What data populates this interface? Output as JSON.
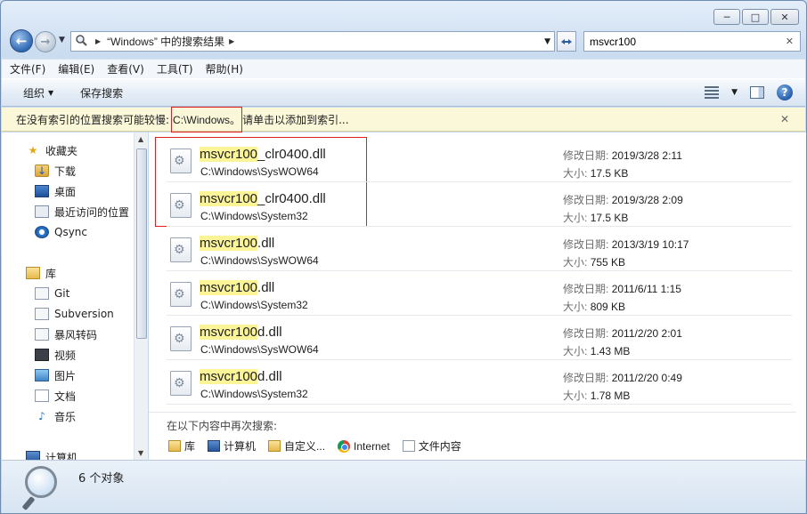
{
  "window": {
    "minimize_glyph": "─",
    "maximize_glyph": "□",
    "close_glyph": "✕"
  },
  "nav": {
    "back_glyph": "←",
    "forward_glyph": "→"
  },
  "address": {
    "path": "“Windows” 中的搜索结果",
    "sep": "▶"
  },
  "search": {
    "value": "msvcr100",
    "clear_glyph": "✕"
  },
  "menu": [
    "文件(F)",
    "编辑(E)",
    "查看(V)",
    "工具(T)",
    "帮助(H)"
  ],
  "toolbar": {
    "organize": "组织",
    "save_search": "保存搜索",
    "help_glyph": "?"
  },
  "infobar": {
    "prefix": "在没有索引的位置搜索可能较慢:",
    "location": "C:\\Windows。",
    "suffix": "请单击以添加到索引...",
    "close_glyph": "✕"
  },
  "sidebar": {
    "favorites": [
      {
        "label": "收藏夹",
        "icon": "star-icon"
      },
      {
        "label": "下载",
        "icon": "download-folder-icon"
      },
      {
        "label": "桌面",
        "icon": "desktop-icon"
      },
      {
        "label": "最近访问的位置",
        "icon": "recent-places-icon"
      },
      {
        "label": "Qsync",
        "icon": "qsync-icon"
      }
    ],
    "libraries": [
      {
        "label": "库",
        "icon": "library-icon"
      },
      {
        "label": "Git",
        "icon": "git-library-icon"
      },
      {
        "label": "Subversion",
        "icon": "subversion-library-icon"
      },
      {
        "label": "暴风转码",
        "icon": "baofeng-library-icon"
      },
      {
        "label": "视频",
        "icon": "video-library-icon"
      },
      {
        "label": "图片",
        "icon": "picture-library-icon"
      },
      {
        "label": "文档",
        "icon": "document-library-icon"
      },
      {
        "label": "音乐",
        "icon": "music-library-icon"
      }
    ],
    "computer": {
      "label": "计算机",
      "icon": "computer-icon"
    }
  },
  "results": {
    "date_label": "修改日期:",
    "size_label": "大小:",
    "files": [
      {
        "match": "msvcr100",
        "rest": "_clr0400.dll",
        "path": "C:\\Windows\\SysWOW64",
        "date": "2019/3/28 2:11",
        "size": "17.5 KB"
      },
      {
        "match": "msvcr100",
        "rest": "_clr0400.dll",
        "path": "C:\\Windows\\System32",
        "date": "2019/3/28 2:09",
        "size": "17.5 KB"
      },
      {
        "match": "msvcr100",
        "rest": ".dll",
        "path": "C:\\Windows\\SysWOW64",
        "date": "2013/3/19 10:17",
        "size": "755 KB"
      },
      {
        "match": "msvcr100",
        "rest": ".dll",
        "path": "C:\\Windows\\System32",
        "date": "2011/6/11 1:15",
        "size": "809 KB"
      },
      {
        "match": "msvcr100",
        "rest": "d.dll",
        "path": "C:\\Windows\\SysWOW64",
        "date": "2011/2/20 2:01",
        "size": "1.43 MB"
      },
      {
        "match": "msvcr100",
        "rest": "d.dll",
        "path": "C:\\Windows\\System32",
        "date": "2011/2/20 0:49",
        "size": "1.78 MB"
      }
    ]
  },
  "search_again": {
    "heading": "在以下内容中再次搜索:",
    "items": [
      {
        "label": "库",
        "icon": "library-icon"
      },
      {
        "label": "计算机",
        "icon": "computer-icon"
      },
      {
        "label": "自定义...",
        "icon": "custom-folder-icon"
      },
      {
        "label": "Internet",
        "icon": "chrome-icon"
      },
      {
        "label": "文件内容",
        "icon": "file-contents-icon"
      }
    ]
  },
  "status": {
    "count": "6 个对象"
  }
}
